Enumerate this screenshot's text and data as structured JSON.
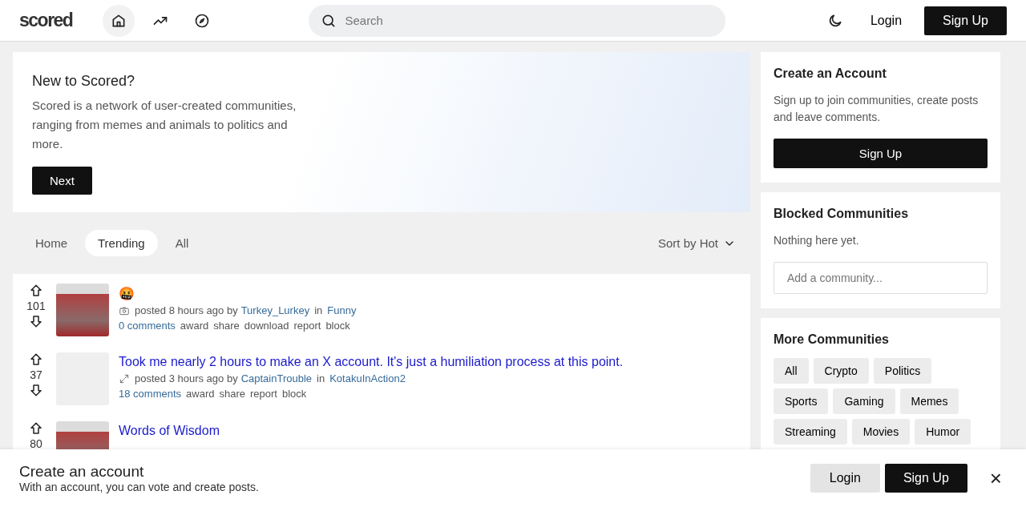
{
  "header": {
    "logo": "scored",
    "nav": [
      {
        "kind": "home",
        "selected": true
      },
      {
        "kind": "trending",
        "selected": false
      },
      {
        "kind": "compass",
        "selected": false
      }
    ],
    "search": {
      "placeholder": "Search"
    },
    "login": "Login",
    "signup": "Sign Up"
  },
  "intro": {
    "title": "New to Scored?",
    "text": "Scored is a network of user-created communities, ranging from memes and animals to politics and more.",
    "button": "Next"
  },
  "feed_tabs": [
    {
      "label": "Home",
      "selected": false
    },
    {
      "label": "Trending",
      "selected": true
    },
    {
      "label": "All",
      "selected": false
    }
  ],
  "sort": "Sort by Hot",
  "posts": [
    {
      "score": "101",
      "title": "🤬",
      "kind": "image",
      "meta": "posted 8 hours ago by",
      "author": "Turkey_Lurkey",
      "in": "in",
      "community": "Funny",
      "comments": "0 comments",
      "actions": [
        "award",
        "share",
        "download",
        "report",
        "block"
      ]
    },
    {
      "score": "37",
      "title": "Took me nearly 2 hours to make an X account. It's just a humiliation process at this point.",
      "kind": "link",
      "meta": "posted 3 hours ago by",
      "author": "CaptainTrouble",
      "in": "in",
      "community": "KotakuInAction2",
      "comments": "18 comments",
      "actions": [
        "award",
        "share",
        "report",
        "block"
      ]
    },
    {
      "score": "80",
      "kind": "image",
      "title": "Words of Wisdom"
    }
  ],
  "sidebar": {
    "account": {
      "title": "Create an Account",
      "text": "Sign up to join communities, create posts and leave comments.",
      "button": "Sign Up"
    },
    "blocked": {
      "title": "Blocked Communities",
      "text": "Nothing here yet.",
      "placeholder": "Add a community..."
    },
    "more": {
      "title": "More Communities",
      "tags": [
        "All",
        "Crypto",
        "Politics",
        "Sports",
        "Gaming",
        "Memes",
        "Streaming",
        "Movies",
        "Humor"
      ]
    }
  },
  "banner": {
    "title": "Create an account",
    "text": "With an account, you can vote and create posts.",
    "login": "Login",
    "signup": "Sign Up",
    "close": "×"
  }
}
